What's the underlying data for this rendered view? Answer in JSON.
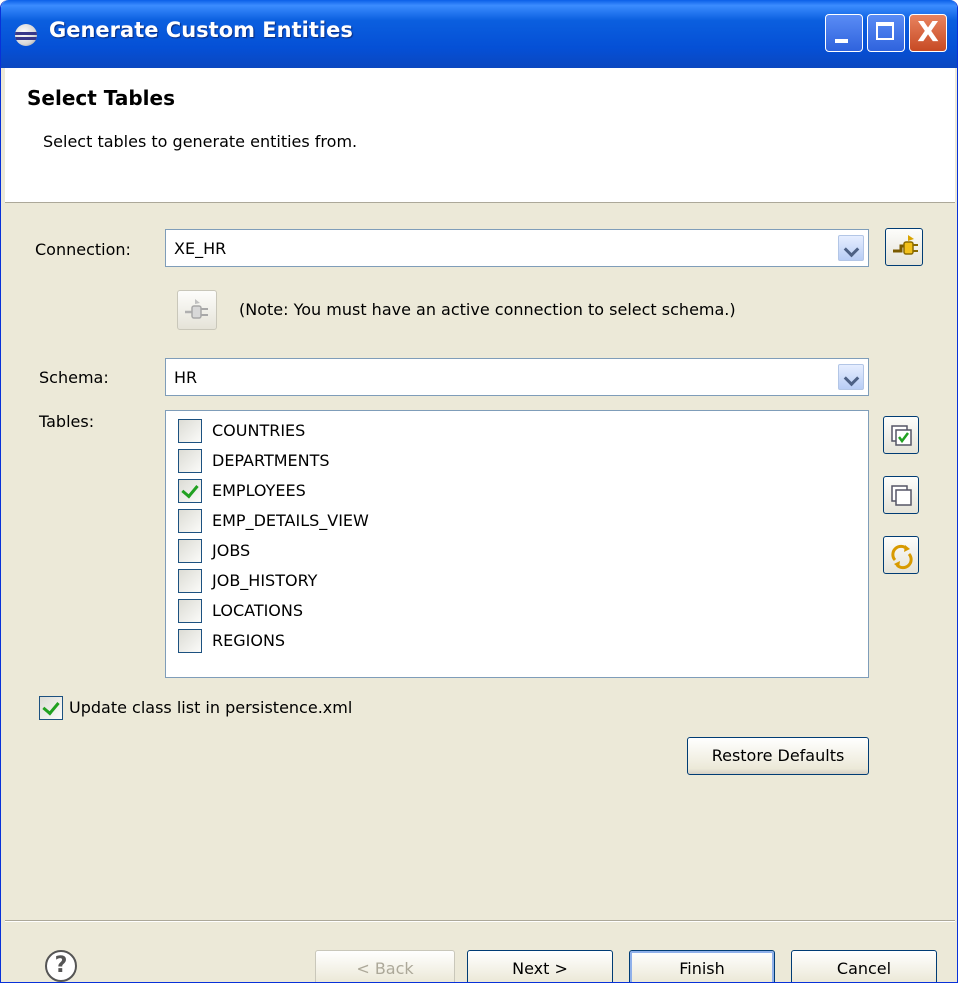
{
  "window": {
    "title": "Generate Custom Entities",
    "minimize": "_",
    "maximize": "□",
    "close": "X"
  },
  "header": {
    "title": "Select Tables",
    "description": "Select tables to generate entities from."
  },
  "connection": {
    "label": "Connection:",
    "value": "XE_HR",
    "note": "(Note: You must have an active connection to select schema.)"
  },
  "schema": {
    "label": "Schema:",
    "value": "HR"
  },
  "tables": {
    "label": "Tables:",
    "items": [
      {
        "name": "COUNTRIES",
        "checked": false
      },
      {
        "name": "DEPARTMENTS",
        "checked": false
      },
      {
        "name": "EMPLOYEES",
        "checked": true
      },
      {
        "name": "EMP_DETAILS_VIEW",
        "checked": false
      },
      {
        "name": "JOBS",
        "checked": false
      },
      {
        "name": "JOB_HISTORY",
        "checked": false
      },
      {
        "name": "LOCATIONS",
        "checked": false
      },
      {
        "name": "REGIONS",
        "checked": false
      }
    ]
  },
  "options": {
    "update_class_list": {
      "label": "Update class list in persistence.xml",
      "checked": true
    }
  },
  "buttons": {
    "restore_defaults": "Restore Defaults",
    "back": "< Back",
    "next": "Next >",
    "finish": "Finish",
    "cancel": "Cancel",
    "help": "?"
  }
}
